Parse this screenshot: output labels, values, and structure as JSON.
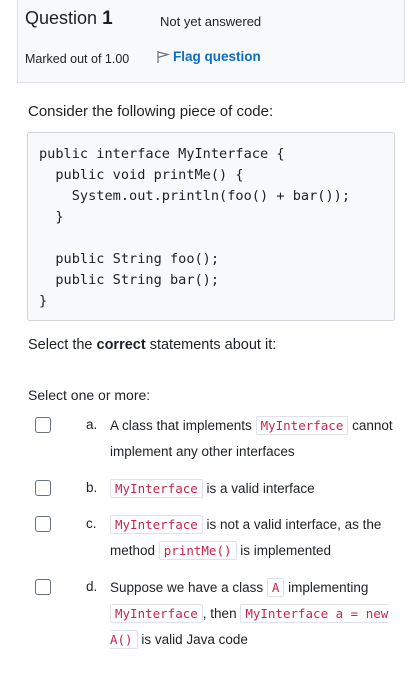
{
  "info": {
    "question_word": "Question",
    "question_number": "1",
    "state": "Not yet answered",
    "grade": "Marked out of 1.00",
    "flag_label": "Flag question"
  },
  "question": {
    "prompt": "Consider the following piece of code:",
    "code": "public interface MyInterface {\n  public void printMe() {\n    System.out.println(foo() + bar());\n  }\n\n  public String foo();\n  public String bar();\n}",
    "instruction_pre": "Select the ",
    "instruction_bold": "correct",
    "instruction_post": " statements about it:",
    "select_prompt": "Select one or more:"
  },
  "options": {
    "a": {
      "letter": "a.",
      "t1": "A class that implements ",
      "c1": "MyInterface",
      "t2": " cannot implement any other interfaces"
    },
    "b": {
      "letter": "b.",
      "c1": "MyInterface",
      "t1": " is a valid interface"
    },
    "c": {
      "letter": "c.",
      "c1": "MyInterface",
      "t1": " is not a valid interface, as the method ",
      "c2": "printMe()",
      "t2": " is implemented"
    },
    "d": {
      "letter": "d.",
      "t1": "Suppose we have a class ",
      "c1": "A",
      "t2": " implementing ",
      "c2": "MyInterface",
      "t3": ", then ",
      "c3": "MyInterface a = new A()",
      "t4": " is valid Java code"
    }
  }
}
